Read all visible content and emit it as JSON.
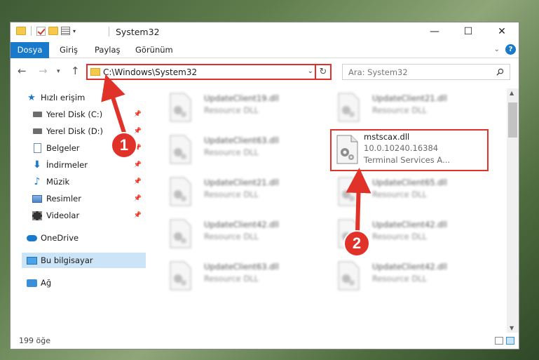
{
  "window": {
    "title": "System32",
    "controls": {
      "minimize": "—",
      "maximize": "☐",
      "close": "✕"
    }
  },
  "ribbon": {
    "tabs": [
      "Dosya",
      "Giriş",
      "Paylaş",
      "Görünüm"
    ]
  },
  "address": {
    "path": "C:\\Windows\\System32",
    "search_placeholder": "Ara: System32"
  },
  "nav": {
    "quick_access": "Hızlı erişim",
    "items": [
      {
        "label": "Yerel Disk (C:)",
        "icon": "disk-icon",
        "pinned": true
      },
      {
        "label": "Yerel Disk (D:)",
        "icon": "disk-icon",
        "pinned": true
      },
      {
        "label": "Belgeler",
        "icon": "documents-icon",
        "pinned": true
      },
      {
        "label": "İndirmeler",
        "icon": "downloads-icon",
        "pinned": true
      },
      {
        "label": "Müzik",
        "icon": "music-icon",
        "pinned": true
      },
      {
        "label": "Resimler",
        "icon": "pictures-icon",
        "pinned": true
      },
      {
        "label": "Videolar",
        "icon": "videos-icon",
        "pinned": true
      }
    ],
    "onedrive": "OneDrive",
    "this_pc": "Bu bilgisayar",
    "network": "Ağ"
  },
  "files": {
    "col1": [
      {
        "name": "UpdateClient19.dll",
        "type": "Resource DLL"
      },
      {
        "name": "UpdateClient63.dll",
        "type": "Resource DLL"
      },
      {
        "name": "UpdateClient21.dll",
        "type": "Resource DLL"
      },
      {
        "name": "UpdateClient42.dll",
        "type": "Resource DLL"
      },
      {
        "name": "UpdateClient63.dll",
        "type": "Resource DLL"
      }
    ],
    "col2": [
      {
        "name": "UpdateClient21.dll",
        "type": "Resource DLL"
      },
      {
        "name": "UpdateClient65.dll",
        "type": "Resource DLL"
      },
      {
        "name": "UpdateClient42.dll",
        "type": "Resource DLL"
      },
      {
        "name": "UpdateClient42.dll",
        "type": "Resource DLL"
      }
    ],
    "highlighted": {
      "name": "mstscax.dll",
      "version": "10.0.10240.16384",
      "description": "Terminal Services A..."
    }
  },
  "status": {
    "count": "199 öğe"
  },
  "annotations": {
    "marker1": "1",
    "marker2": "2",
    "color": "#e1322a"
  }
}
